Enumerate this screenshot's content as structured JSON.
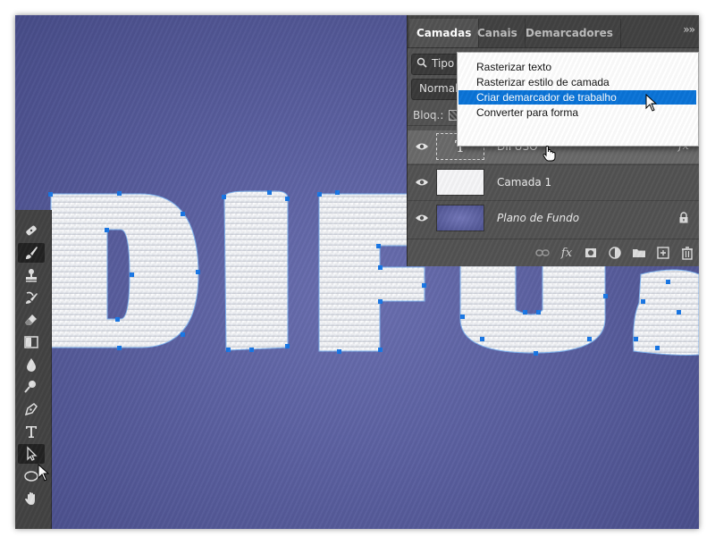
{
  "canvas": {
    "artwork_text": "DIFUSO",
    "background_color": "#5a5f9f",
    "path_anchor_color": "#1877e6"
  },
  "toolbar": {
    "tools": [
      {
        "icon": "healing-brush-icon"
      },
      {
        "icon": "brush-icon",
        "active": true
      },
      {
        "icon": "clone-stamp-icon"
      },
      {
        "icon": "history-brush-icon"
      },
      {
        "icon": "eraser-icon"
      },
      {
        "icon": "gradient-icon"
      },
      {
        "icon": "blur-drop-icon"
      },
      {
        "icon": "dodge-icon"
      },
      {
        "icon": "pen-icon"
      },
      {
        "icon": "type-icon"
      },
      {
        "icon": "path-selection-icon",
        "active": true
      },
      {
        "icon": "ellipse-icon"
      },
      {
        "icon": "hand-icon"
      }
    ]
  },
  "layers_panel": {
    "tabs": [
      {
        "label": "Camadas",
        "active": true
      },
      {
        "label": "Canais"
      },
      {
        "label": "Demarcadores"
      }
    ],
    "filter_label": "Tipo",
    "blend_mode": "Normal",
    "lock_label": "Bloq.:",
    "layers": [
      {
        "name": "DIFUSO",
        "type": "text",
        "thumb_glyph": "T",
        "fx": "fx",
        "selected": true
      },
      {
        "name": "Camada 1",
        "type": "pixel"
      },
      {
        "name": "Plano de Fundo",
        "type": "background",
        "italic": true,
        "locked": true
      }
    ],
    "footer_icons": [
      "link-icon",
      "fx-icon",
      "mask-icon",
      "adjustment-icon",
      "folder-icon",
      "new-layer-icon",
      "trash-icon"
    ],
    "footer_fx_label": "fx"
  },
  "context_menu": {
    "items": [
      {
        "label": "Rasterizar texto"
      },
      {
        "label": "Rasterizar estilo de camada"
      },
      {
        "label": "Criar demarcador de trabalho",
        "highlighted": true
      },
      {
        "label": "Converter para forma"
      }
    ]
  }
}
